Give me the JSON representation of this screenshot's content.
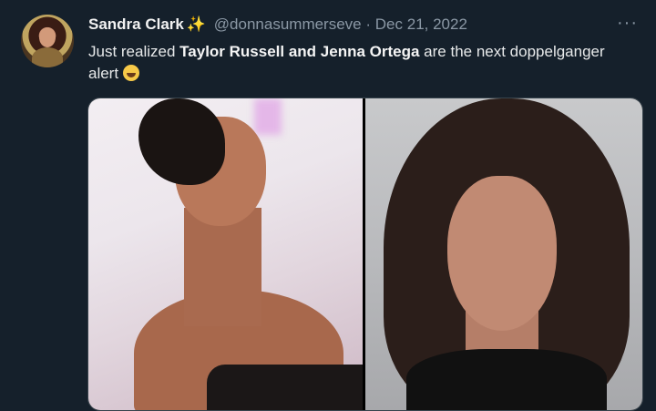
{
  "tweet": {
    "author_name": "Sandra Clark",
    "author_badge": "✨",
    "handle": "@donnasummerseve",
    "separator": "·",
    "date": "Dec 21, 2022",
    "more_label": "···",
    "text_prefix": "Just realized ",
    "text_bold": "Taylor Russell and Jenna Ortega",
    "text_suffix": " are the next doppelganger alert"
  },
  "media": {
    "images": [
      {
        "subject": "woman with short dark hair in strapless black dress"
      },
      {
        "subject": "woman with long dark hair in black top"
      }
    ]
  },
  "colors": {
    "background": "#15202b",
    "text": "#e7e9ea",
    "secondary": "#8b98a5",
    "badge": "#f7c948"
  }
}
